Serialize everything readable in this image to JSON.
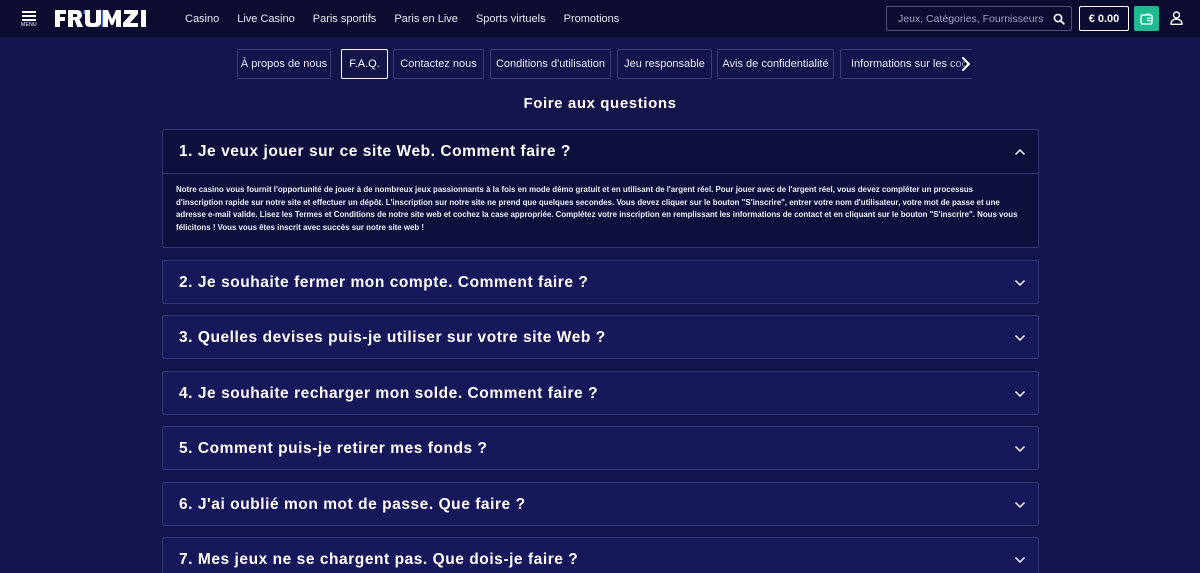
{
  "header": {
    "menu_label": "MENU",
    "logo_text": "FRUMZI",
    "nav": [
      "Casino",
      "Live Casino",
      "Paris sportifs",
      "Paris en Live",
      "Sports virtuels",
      "Promotions"
    ],
    "search_placeholder": "Jeux, Catégories, Fournisseurs",
    "balance": "€ 0.00",
    "accent_color": "#1dbb8f"
  },
  "tabs": {
    "items": [
      "À propos de nous",
      "F.A.Q.",
      "Contactez nous",
      "Conditions d'utilisation",
      "Jeu responsable",
      "Avis de confidentialité",
      "Informations sur les coo"
    ],
    "active": "F.A.Q."
  },
  "page_title": "Foire aux questions",
  "faq": [
    {
      "question": "1. Je veux jouer sur ce site Web. Comment faire ?",
      "answer": "Notre casino vous fournit l'opportunité de jouer à de nombreux jeux passionnants à la fois en mode démo gratuit et en utilisant de l'argent réel. Pour jouer avec de l'argent réel, vous devez compléter un processus d'inscription rapide sur notre site et effectuer un dépôt. L'inscription sur notre site ne prend que quelques secondes. Vous devez cliquer sur le bouton \"S'inscrire\", entrer votre nom d'utilisateur, votre mot de passe et une adresse e-mail valide. Lisez les Termes et Conditions de notre site web et cochez la case appropriée. Complétez votre inscription en remplissant les informations de contact et en cliquant sur le bouton \"S'inscrire\". Nous vous félicitons ! Vous vous êtes inscrit avec succès sur notre site web !",
      "expanded": true
    },
    {
      "question": "2. Je souhaite fermer mon compte. Comment faire ?",
      "expanded": false
    },
    {
      "question": "3. Quelles devises puis-je utiliser sur votre site Web ?",
      "expanded": false
    },
    {
      "question": "4. Je souhaite recharger mon solde. Comment faire ?",
      "expanded": false
    },
    {
      "question": "5. Comment puis-je retirer mes fonds ?",
      "expanded": false
    },
    {
      "question": "6. J'ai oublié mon mot de passe. Que faire ?",
      "expanded": false
    },
    {
      "question": "7. Mes jeux ne se chargent pas. Que dois-je faire ?",
      "expanded": false
    }
  ]
}
